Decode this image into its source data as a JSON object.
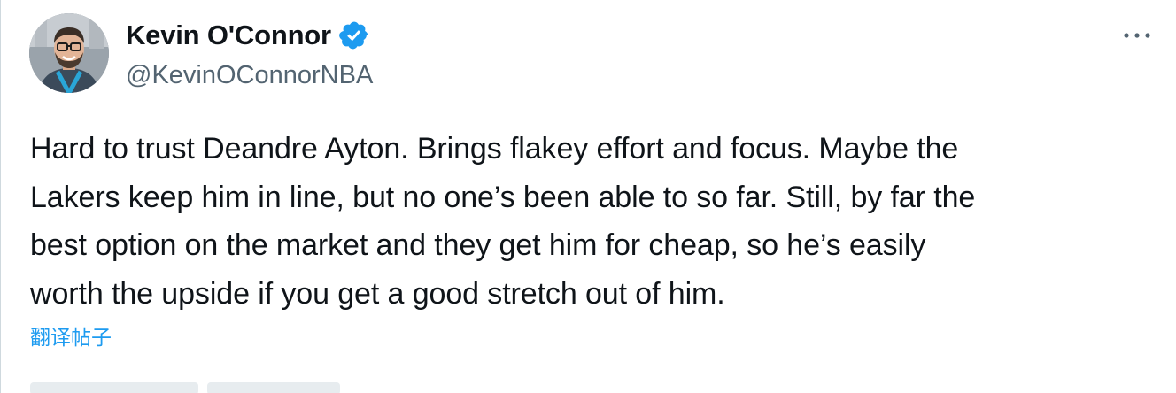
{
  "author": {
    "display_name": "Kevin O'Connor",
    "handle": "@KevinOConnorNBA",
    "verified": true
  },
  "tweet": {
    "text": "Hard to trust Deandre Ayton. Brings flakey effort and focus. Maybe the\nLakers keep him in line, but no one’s been able to so far. Still, by far the\nbest option on the market and they get him for cheap, so he’s easily\nworth the upside if you get a good stretch out of him.",
    "translate_label": "翻译帖子"
  },
  "icons": {
    "verified": "verified-badge-icon",
    "more": "more-options-icon"
  },
  "colors": {
    "accent": "#1d9bf0",
    "secondary_text": "#536471",
    "primary_text": "#0f1419"
  }
}
